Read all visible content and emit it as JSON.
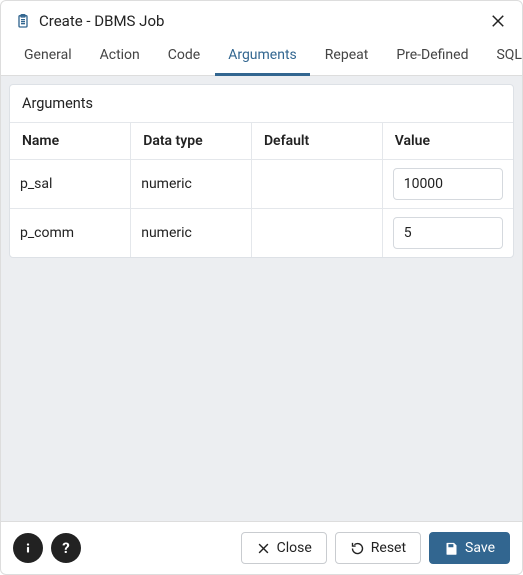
{
  "header": {
    "title": "Create - DBMS Job"
  },
  "tabs": [
    {
      "label": "General",
      "active": false
    },
    {
      "label": "Action",
      "active": false
    },
    {
      "label": "Code",
      "active": false
    },
    {
      "label": "Arguments",
      "active": true
    },
    {
      "label": "Repeat",
      "active": false
    },
    {
      "label": "Pre-Defined",
      "active": false
    },
    {
      "label": "SQL",
      "active": false
    }
  ],
  "panel": {
    "title": "Arguments",
    "columns": {
      "name": "Name",
      "data_type": "Data type",
      "default": "Default",
      "value": "Value"
    },
    "rows": [
      {
        "name": "p_sal",
        "data_type": "numeric",
        "default": "",
        "value": "10000"
      },
      {
        "name": "p_comm",
        "data_type": "numeric",
        "default": "",
        "value": "5"
      }
    ]
  },
  "footer": {
    "info_label": "i",
    "help_label": "?",
    "close_label": "Close",
    "reset_label": "Reset",
    "save_label": "Save"
  }
}
